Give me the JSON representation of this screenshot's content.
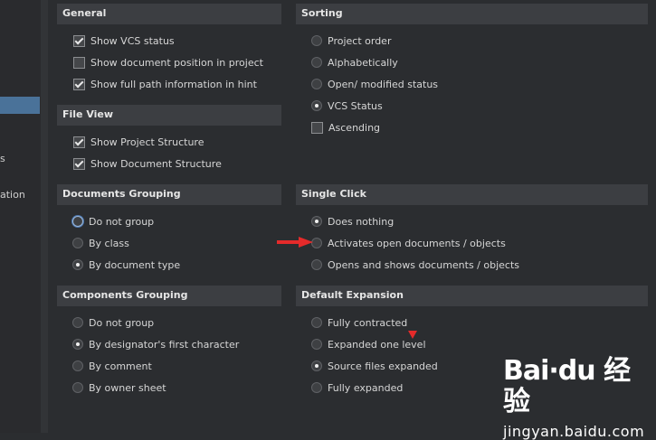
{
  "sidebar": {
    "fragments": [
      "s",
      "ation"
    ]
  },
  "general": {
    "title": "General",
    "items": [
      {
        "label": "Show VCS status",
        "checked": true
      },
      {
        "label": "Show document position in project",
        "checked": false
      },
      {
        "label": "Show full path information in hint",
        "checked": true
      }
    ]
  },
  "file_view": {
    "title": "File View",
    "items": [
      {
        "label": "Show Project Structure",
        "checked": true
      },
      {
        "label": "Show Document Structure",
        "checked": true
      }
    ]
  },
  "documents_grouping": {
    "title": "Documents Grouping",
    "items": [
      {
        "label": "Do not group",
        "selected": false
      },
      {
        "label": "By class",
        "selected": false
      },
      {
        "label": "By document type",
        "selected": true
      }
    ]
  },
  "components_grouping": {
    "title": "Components Grouping",
    "items": [
      {
        "label": "Do not group",
        "selected": false
      },
      {
        "label": "By designator's first character",
        "selected": true
      },
      {
        "label": "By comment",
        "selected": false
      },
      {
        "label": "By owner sheet",
        "selected": false
      }
    ]
  },
  "sorting": {
    "title": "Sorting",
    "items": [
      {
        "label": "Project order",
        "selected": false
      },
      {
        "label": "Alphabetically",
        "selected": false
      },
      {
        "label": "Open/ modified status",
        "selected": false
      },
      {
        "label": "VCS Status",
        "selected": true
      }
    ],
    "ascending": {
      "label": "Ascending",
      "checked": false
    }
  },
  "single_click": {
    "title": "Single Click",
    "items": [
      {
        "label": "Does nothing",
        "selected": true
      },
      {
        "label": "Activates open documents / objects",
        "selected": false
      },
      {
        "label": "Opens and shows documents / objects",
        "selected": false
      }
    ]
  },
  "default_expansion": {
    "title": "Default Expansion",
    "items": [
      {
        "label": "Fully contracted",
        "selected": false
      },
      {
        "label": "Expanded one level",
        "selected": false
      },
      {
        "label": "Source files expanded",
        "selected": true
      },
      {
        "label": "Fully expanded",
        "selected": false
      }
    ]
  },
  "watermark": {
    "logo": "Bai·du 经验",
    "url": "jingyan.baidu.com"
  },
  "colors": {
    "background": "#2b2d30",
    "section_header": "#3c3e42",
    "sidebar_selection": "#4a7299",
    "annotation_red": "#e52a2a"
  }
}
